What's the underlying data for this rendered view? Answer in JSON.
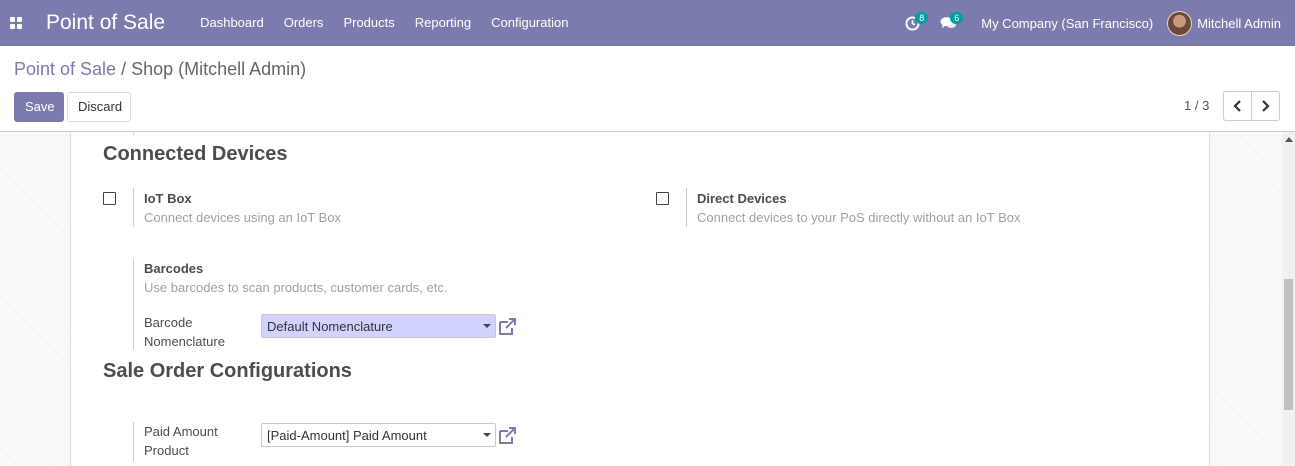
{
  "navbar": {
    "app_title": "Point of Sale",
    "menu": [
      "Dashboard",
      "Orders",
      "Products",
      "Reporting",
      "Configuration"
    ],
    "activity_badge": "8",
    "messages_badge": "6",
    "company": "My Company (San Francisco)",
    "user": "Mitchell Admin",
    "color": "#7c7bad"
  },
  "breadcrumb": {
    "parent": "Point of Sale",
    "separator": "/",
    "current": "Shop (Mitchell Admin)"
  },
  "buttons": {
    "save": "Save",
    "discard": "Discard"
  },
  "pager": {
    "value": "1 / 3"
  },
  "connected_devices": {
    "title": "Connected Devices",
    "iot_box": {
      "label": "IoT Box",
      "help": "Connect devices using an IoT Box",
      "checked": false
    },
    "direct_devices": {
      "label": "Direct Devices",
      "help": "Connect devices to your PoS directly without an IoT Box",
      "checked": false
    },
    "barcodes": {
      "label": "Barcodes",
      "help": "Use barcodes to scan products, customer cards, etc.",
      "nomenclature_label_line1": "Barcode",
      "nomenclature_label_line2": "Nomenclature",
      "nomenclature_value": "Default Nomenclature"
    }
  },
  "sale_order": {
    "title": "Sale Order Configurations",
    "paid_amount_label_line1": "Paid Amount",
    "paid_amount_label_line2": "Product",
    "paid_amount_value": "[Paid-Amount] Paid Amount"
  }
}
